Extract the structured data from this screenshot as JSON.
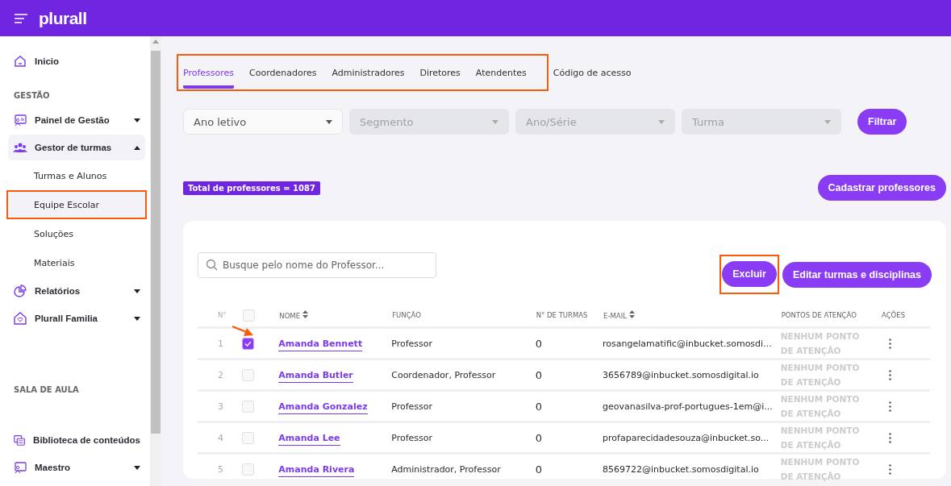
{
  "header": {
    "logo": "plurall"
  },
  "sidebar": {
    "items": [
      {
        "kind": "item",
        "label": "Inicio",
        "selected": false
      },
      {
        "kind": "section",
        "label": "GESTÃO"
      },
      {
        "kind": "item",
        "label": "Painel de Gestão",
        "expanded": false,
        "selected": false
      },
      {
        "kind": "item",
        "label": "Gestor de turmas",
        "expanded": true,
        "selected": true
      },
      {
        "kind": "sub",
        "label": "Turmas e Alunos",
        "selected": false,
        "highlighted": false
      },
      {
        "kind": "sub",
        "label": "Equipe Escolar",
        "selected": true,
        "highlighted": true
      },
      {
        "kind": "sub",
        "label": "Soluções",
        "selected": false,
        "highlighted": false
      },
      {
        "kind": "sub",
        "label": "Materiais",
        "selected": false,
        "highlighted": false
      },
      {
        "kind": "item",
        "label": "Relatórios",
        "expanded": false,
        "selected": false
      },
      {
        "kind": "item",
        "label": "Plurall Familia",
        "expanded": false,
        "selected": false
      },
      {
        "kind": "section",
        "label": "SALA DE AULA"
      },
      {
        "kind": "item",
        "label": "Biblioteca de conteúdos",
        "selected": false
      },
      {
        "kind": "item",
        "label": "Maestro",
        "expanded": false,
        "selected": false
      }
    ]
  },
  "tab_groups": [
    {
      "framed": true,
      "tabs": [
        {
          "label": "Professores",
          "selected": true
        },
        {
          "label": "Coordenadores",
          "selected": false
        },
        {
          "label": "Administradores",
          "selected": false
        },
        {
          "label": "Diretores",
          "selected": false
        },
        {
          "label": "Atendentes",
          "selected": false
        }
      ]
    },
    {
      "framed": false,
      "tabs": [
        {
          "label": "Código de acesso",
          "selected": false
        }
      ]
    }
  ],
  "filters": [
    {
      "placeholder": "Ano letivo",
      "disabled": false
    },
    {
      "placeholder": "Segmento",
      "disabled": true
    },
    {
      "placeholder": "Ano/Série",
      "disabled": true
    },
    {
      "placeholder": "Turma",
      "disabled": true
    }
  ],
  "filter_button": "Filtrar",
  "total_badge": "Total de professores = 1087",
  "register_button": "Cadastrar professores",
  "search": {
    "placeholder": "Busque pelo nome do Professor..."
  },
  "actions": [
    {
      "label": "Excluir",
      "highlighted": true
    },
    {
      "label": "Editar turmas e disciplinas",
      "highlighted": false
    }
  ],
  "table": {
    "columns": [
      "N°",
      "NOME",
      "FUNÇÃO",
      "N° DE TURMAS",
      "E-MAIL",
      "PONTOS DE ATENÇÃO",
      "AÇÕES"
    ],
    "header_checked": false,
    "rows": [
      {
        "n": "1",
        "checked": true,
        "arrow": true,
        "name": "Amanda Bennett",
        "role": "Professor",
        "classes": "0",
        "email": "rosangelamatific@inbucket.somosdi...",
        "attention": "NENHUM PONTO DE ATENÇÃO"
      },
      {
        "n": "2",
        "checked": false,
        "arrow": false,
        "name": "Amanda Butler",
        "role": "Coordenador, Professor",
        "classes": "0",
        "email": "3656789@inbucket.somosdigital.io",
        "attention": "NENHUM PONTO DE ATENÇÃO"
      },
      {
        "n": "3",
        "checked": false,
        "arrow": false,
        "name": "Amanda Gonzalez",
        "role": "Professor",
        "classes": "0",
        "email": "geovanasilva-prof-portugues-1em@i...",
        "attention": "NENHUM PONTO DE ATENÇÃO"
      },
      {
        "n": "4",
        "checked": false,
        "arrow": false,
        "name": "Amanda Lee",
        "role": "Professor",
        "classes": "0",
        "email": "profaparecidadesouza@inbucket.so...",
        "attention": "NENHUM PONTO DE ATENÇÃO"
      },
      {
        "n": "5",
        "checked": false,
        "arrow": false,
        "name": "Amanda Rivera",
        "role": "Administrador, Professor",
        "classes": "0",
        "email": "8569722@inbucket.somosdigital.io",
        "attention": "NENHUM PONTO DE ATENÇÃO"
      }
    ]
  }
}
